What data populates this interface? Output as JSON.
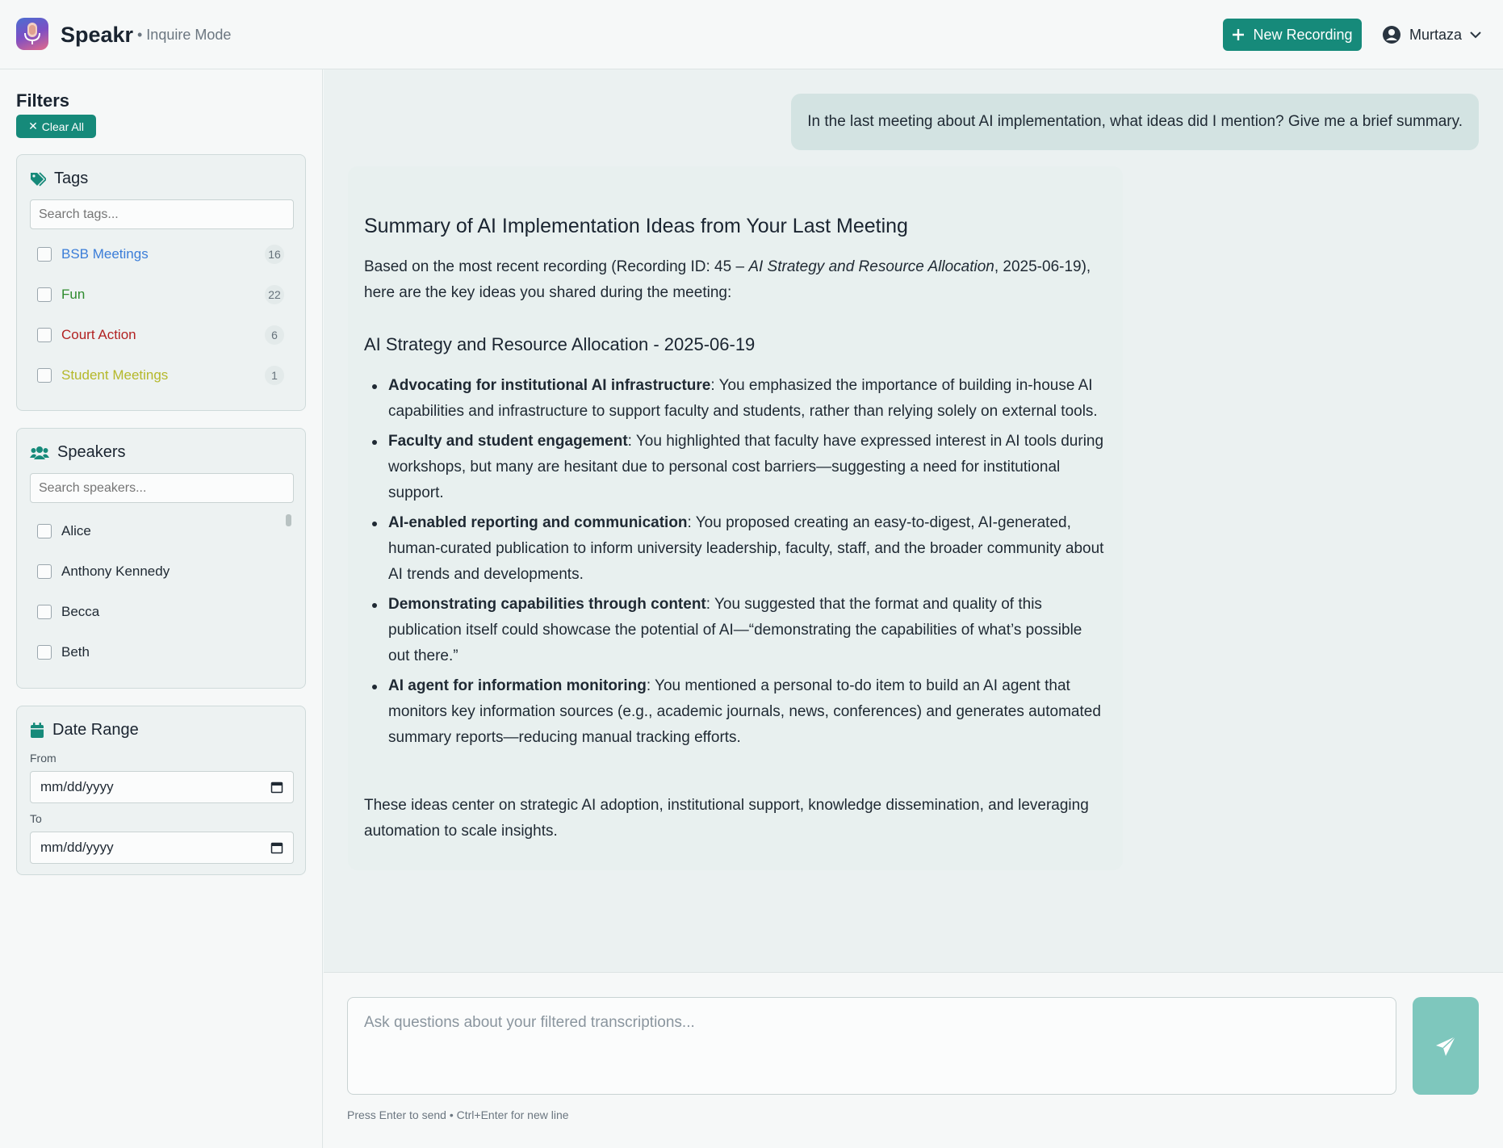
{
  "header": {
    "app_name": "Speakr",
    "mode": "• Inquire Mode",
    "new_recording_label": "New Recording",
    "user_name": "Murtaza"
  },
  "sidebar": {
    "title": "Filters",
    "clear_all_label": "Clear All",
    "tags": {
      "title": "Tags",
      "search_placeholder": "Search tags...",
      "items": [
        {
          "label": "BSB Meetings",
          "count": "16",
          "color": "#3b7dd8"
        },
        {
          "label": "Fun",
          "count": "22",
          "color": "#2e8b2e"
        },
        {
          "label": "Court Action",
          "count": "6",
          "color": "#b22222"
        },
        {
          "label": "Student Meetings",
          "count": "1",
          "color": "#b5b82a"
        }
      ]
    },
    "speakers": {
      "title": "Speakers",
      "search_placeholder": "Search speakers...",
      "items": [
        "Alice",
        "Anthony Kennedy",
        "Becca",
        "Beth"
      ]
    },
    "date_range": {
      "title": "Date Range",
      "from_label": "From",
      "to_label": "To",
      "from_value": "mm/dd/yyyy",
      "to_value": "mm/dd/yyyy"
    }
  },
  "chat": {
    "user_message": "In the last meeting about AI implementation, what ideas did I mention? Give me a brief summary.",
    "response": {
      "heading": "Summary of AI Implementation Ideas from Your Last Meeting",
      "intro_pre": "Based on the most recent recording (Recording ID: 45 – ",
      "intro_italic": "AI Strategy and Resource Allocation",
      "intro_post": ", 2025-06-19), here are the key ideas you shared during the meeting:",
      "subheading": "AI Strategy and Resource Allocation - 2025-06-19",
      "bullets": [
        {
          "bold": "Advocating for institutional AI infrastructure",
          "text": ": You emphasized the importance of building in-house AI capabilities and infrastructure to support faculty and students, rather than relying solely on external tools."
        },
        {
          "bold": "Faculty and student engagement",
          "text": ": You highlighted that faculty have expressed interest in AI tools during workshops, but many are hesitant due to personal cost barriers—suggesting a need for institutional support."
        },
        {
          "bold": "AI-enabled reporting and communication",
          "text": ": You proposed creating an easy-to-digest, AI-generated, human-curated publication to inform university leadership, faculty, staff, and the broader community about AI trends and developments."
        },
        {
          "bold": "Demonstrating capabilities through content",
          "text": ": You suggested that the format and quality of this publication itself could showcase the potential of AI—“demonstrating the capabilities of what’s possible out there.”"
        },
        {
          "bold": "AI agent for information monitoring",
          "text": ": You mentioned a personal to-do item to build an AI agent that monitors key information sources (e.g., academic journals, news, conferences) and generates automated summary reports—reducing manual tracking efforts."
        }
      ],
      "conclusion": "These ideas center on strategic AI adoption, institutional support, knowledge dissemination, and leveraging automation to scale insights."
    }
  },
  "input": {
    "placeholder": "Ask questions about your filtered transcriptions...",
    "hint": "Press Enter to send • Ctrl+Enter for new line"
  }
}
